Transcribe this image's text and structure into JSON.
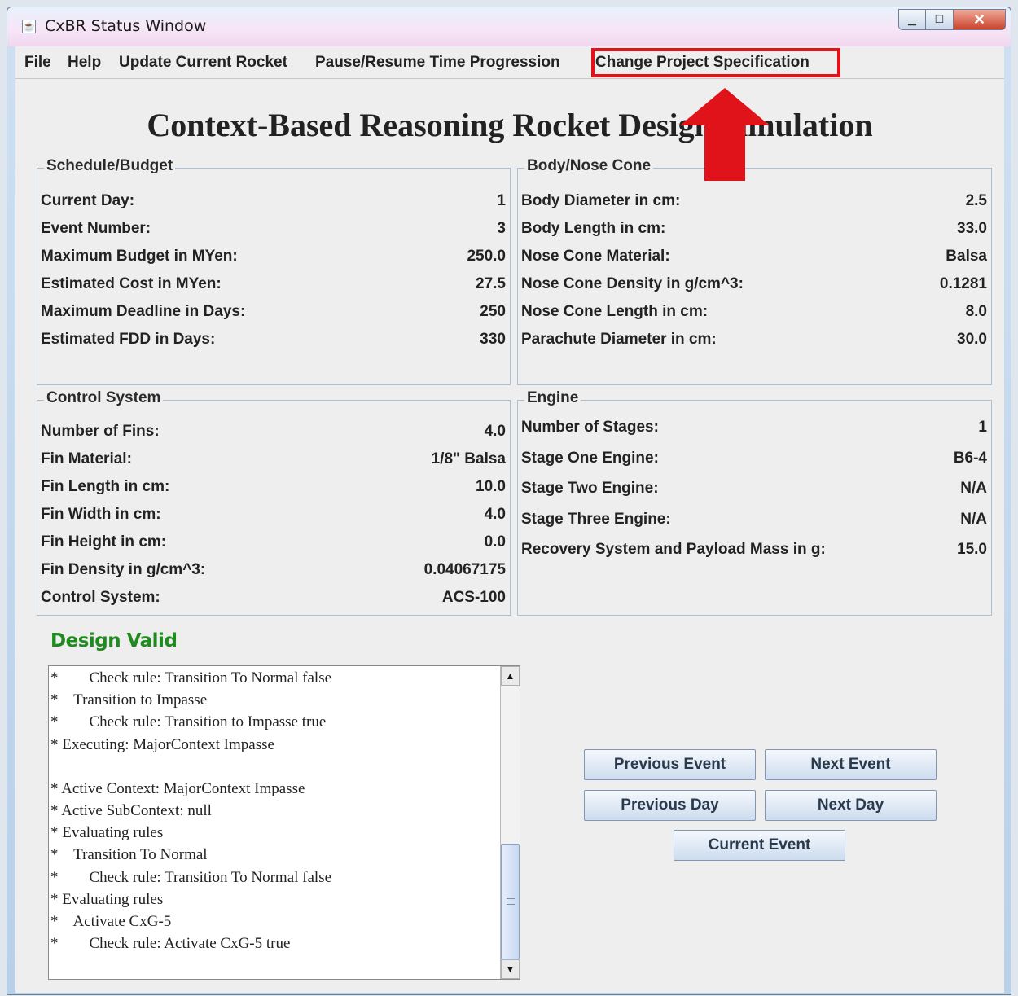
{
  "window": {
    "title": "CxBR Status Window"
  },
  "menu": [
    "File",
    "Help",
    "Update Current Rocket",
    "Pause/Resume Time Progression",
    "Change Project Specification"
  ],
  "heading": "Context-Based Reasoning Rocket Design Simulation",
  "panels": {
    "schedule": {
      "title": "Schedule/Budget",
      "rows": [
        {
          "label": "Current Day:",
          "value": "1"
        },
        {
          "label": "Event Number:",
          "value": "3"
        },
        {
          "label": "Maximum Budget in MYen:",
          "value": "250.0"
        },
        {
          "label": "Estimated Cost in MYen:",
          "value": "27.5"
        },
        {
          "label": "Maximum Deadline in Days:",
          "value": "250"
        },
        {
          "label": "Estimated FDD in Days:",
          "value": "330"
        }
      ]
    },
    "body": {
      "title": "Body/Nose Cone",
      "rows": [
        {
          "label": "Body Diameter in cm:",
          "value": "2.5"
        },
        {
          "label": "Body Length in cm:",
          "value": "33.0"
        },
        {
          "label": "Nose Cone Material:",
          "value": "Balsa"
        },
        {
          "label": "Nose Cone Density in g/cm^3:",
          "value": "0.1281"
        },
        {
          "label": "Nose Cone Length in cm:",
          "value": "8.0"
        },
        {
          "label": "Parachute Diameter in cm:",
          "value": "30.0"
        }
      ]
    },
    "control": {
      "title": "Control System",
      "rows": [
        {
          "label": "Number of Fins:",
          "value": "4.0"
        },
        {
          "label": "Fin Material:",
          "value": "1/8\" Balsa"
        },
        {
          "label": "Fin Length in cm:",
          "value": "10.0"
        },
        {
          "label": "Fin Width in cm:",
          "value": "4.0"
        },
        {
          "label": "Fin Height in cm:",
          "value": "0.0"
        },
        {
          "label": "Fin Density in g/cm^3:",
          "value": "0.04067175"
        },
        {
          "label": "Control System:",
          "value": "ACS-100"
        }
      ]
    },
    "engine": {
      "title": "Engine",
      "rows": [
        {
          "label": "Number of Stages:",
          "value": "1"
        },
        {
          "label": "Stage One Engine:",
          "value": "B6-4"
        },
        {
          "label": "Stage Two Engine:",
          "value": "N/A"
        },
        {
          "label": "Stage Three Engine:",
          "value": "N/A"
        },
        {
          "label": "Recovery System and Payload Mass in g:",
          "value": "15.0"
        }
      ]
    }
  },
  "status": "Design Valid",
  "log": [
    "*        Check rule: Transition To Normal false",
    "*    Transition to Impasse",
    "*        Check rule: Transition to Impasse true",
    "* Executing: MajorContext Impasse",
    "",
    "* Active Context: MajorContext Impasse",
    "* Active SubContext: null",
    "* Evaluating rules",
    "*    Transition To Normal",
    "*        Check rule: Transition To Normal false",
    "* Evaluating rules",
    "*    Activate CxG-5",
    "*        Check rule: Activate CxG-5 true"
  ],
  "buttons": {
    "prev_event": "Previous Event",
    "next_event": "Next Event",
    "prev_day": "Previous Day",
    "next_day": "Next Day",
    "current_event": "Current Event"
  },
  "colors": {
    "highlight": "#e0131a",
    "valid": "#1f8a1f"
  }
}
